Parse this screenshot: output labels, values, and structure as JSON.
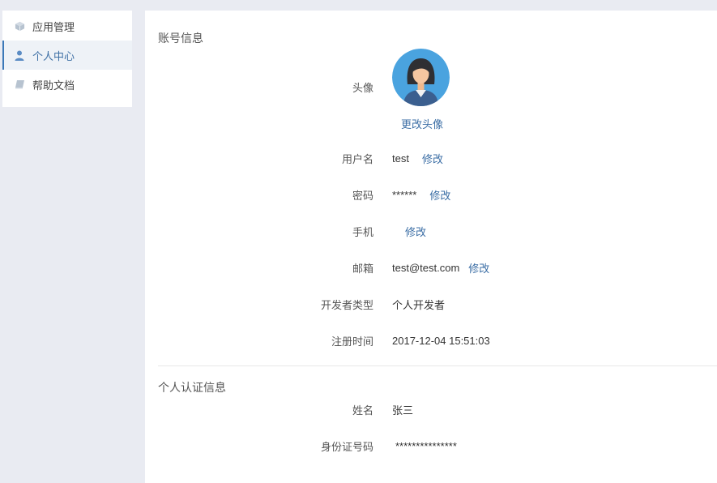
{
  "sidebar": {
    "items": [
      {
        "label": "应用管理",
        "icon": "cube-icon"
      },
      {
        "label": "个人中心",
        "icon": "user-icon",
        "active": true
      },
      {
        "label": "帮助文档",
        "icon": "book-icon"
      }
    ]
  },
  "account": {
    "title": "账号信息",
    "avatar_label": "头像",
    "change_avatar": "更改头像",
    "username_label": "用户名",
    "username": "test",
    "password_label": "密码",
    "password": "******",
    "phone_label": "手机",
    "phone": "",
    "email_label": "邮箱",
    "email": "test@test.com",
    "dev_type_label": "开发者类型",
    "dev_type": "个人开发者",
    "reg_time_label": "注册时间",
    "reg_time": "2017-12-04 15:51:03",
    "edit": "修改"
  },
  "identity": {
    "title": "个人认证信息",
    "name_label": "姓名",
    "name": "张三",
    "id_label": "身份证号码",
    "id_number": "***************"
  },
  "colors": {
    "accent": "#3b6ea5",
    "background": "#e9ebf2",
    "avatar_bg": "#4aa3df"
  }
}
